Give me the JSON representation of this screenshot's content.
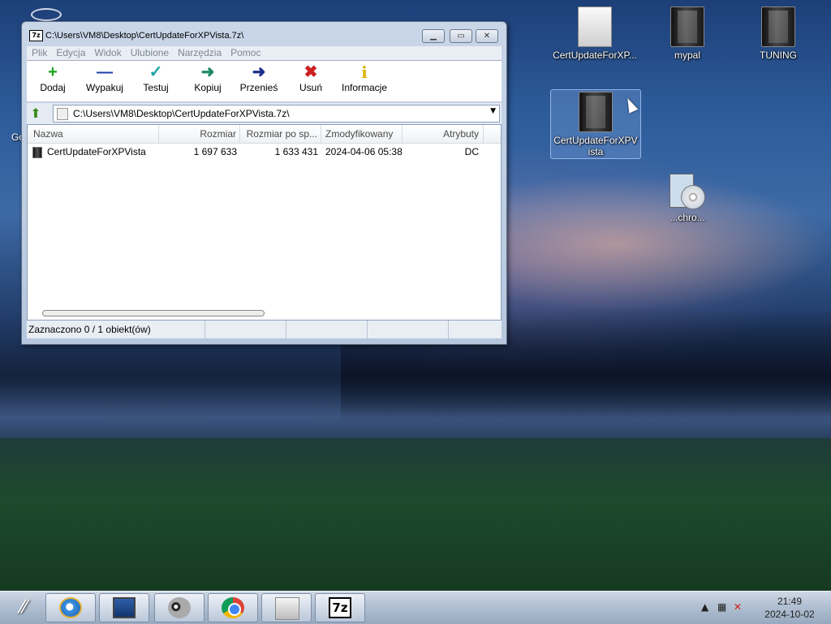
{
  "window": {
    "title": "C:\\Users\\VM8\\Desktop\\CertUpdateForXPVista.7z\\",
    "app_icon_label": "7z",
    "buttons": {
      "minimize": "▁",
      "maximize": "▭",
      "close": "✕"
    }
  },
  "menu": [
    "Plik",
    "Edycja",
    "Widok",
    "Ulubione",
    "Narzędzia",
    "Pomoc"
  ],
  "toolbar": [
    {
      "label": "Dodaj",
      "icon": "plus-icon",
      "glyph": "+",
      "color": "#1aa31a"
    },
    {
      "label": "Wypakuj",
      "icon": "minus-icon",
      "glyph": "—",
      "color": "#1c3fa8"
    },
    {
      "label": "Testuj",
      "icon": "check-icon",
      "glyph": "✓",
      "color": "#1ba6a6"
    },
    {
      "label": "Kopiuj",
      "icon": "copy-arrow-icon",
      "glyph": "➜",
      "color": "#1e8a6a"
    },
    {
      "label": "Przenieś",
      "icon": "move-arrow-icon",
      "glyph": "➜",
      "color": "#1c2f8f"
    },
    {
      "label": "Usuń",
      "icon": "delete-x-icon",
      "glyph": "✖",
      "color": "#cc1f1f"
    },
    {
      "label": "Informacje",
      "icon": "info-icon",
      "glyph": "i",
      "color": "#d8b400"
    }
  ],
  "address": {
    "path": "C:\\Users\\VM8\\Desktop\\CertUpdateForXPVista.7z\\"
  },
  "columns": [
    "Nazwa",
    "Rozmiar",
    "Rozmiar po sp...",
    "Zmodyfikowany",
    "Atrybuty"
  ],
  "rows": [
    {
      "name": "CertUpdateForXPVista",
      "size": "1 697 633",
      "packed": "1 633 431",
      "modified": "2024-04-06 05:38",
      "attributes": "DC"
    }
  ],
  "status": {
    "selection": "Zaznaczono 0 / 1 obiekt(ów)"
  },
  "desktop_icons": [
    {
      "label": "CertUpdateForXP...",
      "icon": "file-icon"
    },
    {
      "label": "mypal",
      "icon": "folder-icon"
    },
    {
      "label": "TUNING",
      "icon": "folder-icon"
    },
    {
      "label": "CertUpdateForXPVista",
      "icon": "folder-icon",
      "selected": true
    },
    {
      "label": "...chro...",
      "icon": "cd-installer-icon"
    }
  ],
  "left_edge_text": "Go",
  "taskbar": {
    "items": [
      "internet-explorer-icon",
      "computer-monitor-icon",
      "raccoon-icon",
      "chrome-icon",
      "document-icon",
      "7zip-icon"
    ],
    "zip_label": "7z"
  },
  "clock": {
    "time": "21:49",
    "date": "2024-10-02"
  }
}
